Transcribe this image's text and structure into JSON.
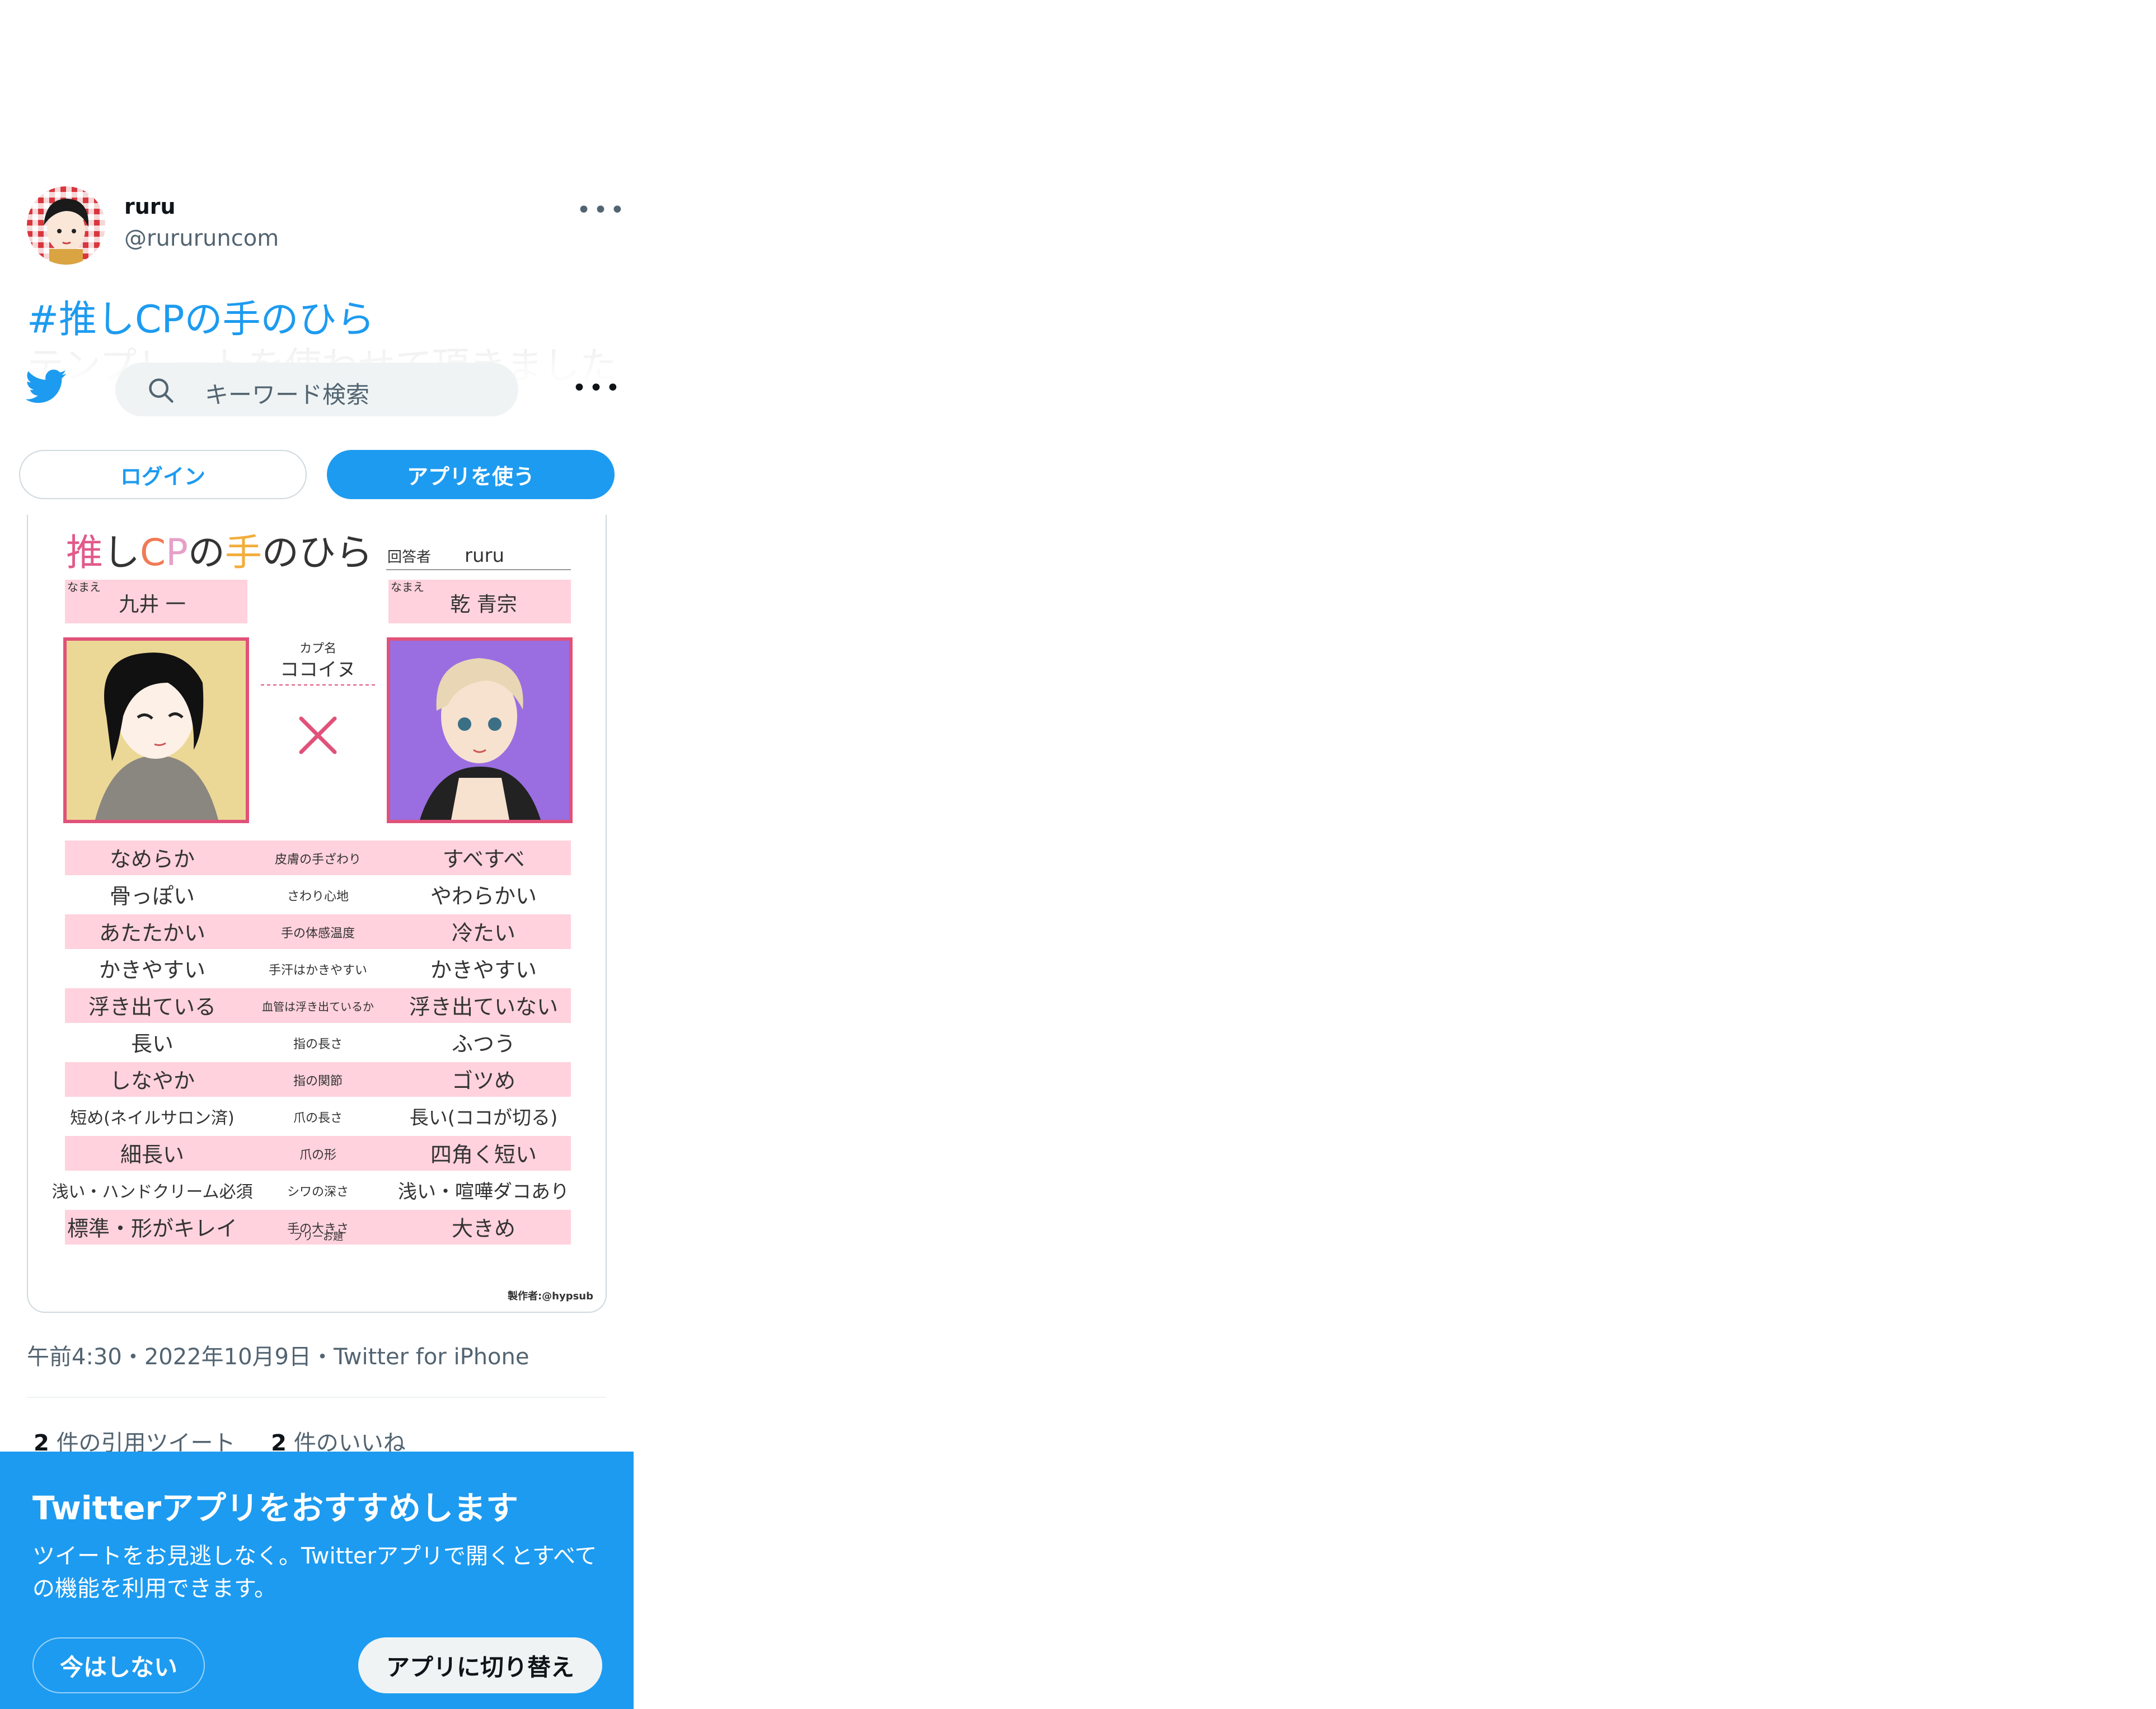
{
  "tweet": {
    "author_name": "ruru",
    "author_handle": "@rururuncom",
    "hashtag": "#推しCPの手のひら",
    "text_line2": "テンプレートを使わせて頂きました",
    "timestamp": "午前4:30・2022年10月9日・Twitter for iPhone",
    "quote_count": "2",
    "quote_label": "件の引用ツイート",
    "like_count": "2",
    "like_label": "件のいいね"
  },
  "topbar": {
    "search_placeholder": "キーワード検索",
    "login_label": "ログイン",
    "use_app_label": "アプリを使う"
  },
  "sheet": {
    "title": "Twitterアプリをおすすめします",
    "body": "ツイートをお見逃しなく。Twitterアプリで開くとすべての機能を利用できます。",
    "not_now_label": "今はしない",
    "switch_label": "アプリに切り替え"
  },
  "template": {
    "title": "推しCPの手のひら",
    "answerer_label": "回答者",
    "answerer": "ruru",
    "name_label": "なまえ",
    "left_name": "九井 一",
    "right_name": "乾 青宗",
    "cp_label": "カプ名",
    "cp_name": "ココイヌ",
    "rows": [
      {
        "left": "なめらか",
        "label": "皮膚の手ざわり",
        "right": "すべすべ"
      },
      {
        "left": "骨っぽい",
        "label": "さわり心地",
        "right": "やわらかい"
      },
      {
        "left": "あたたかい",
        "label": "手の体感温度",
        "right": "冷たい"
      },
      {
        "left": "かきやすい",
        "label": "手汗はかきやすい",
        "right": "かきやすい"
      },
      {
        "left": "浮き出ている",
        "label": "血管は浮き出ているか",
        "right": "浮き出ていない"
      },
      {
        "left": "長い",
        "label": "指の長さ",
        "right": "ふつう"
      },
      {
        "left": "しなやか",
        "label": "指の関節",
        "right": "ゴツめ"
      },
      {
        "left": "短め(ネイルサロン済)",
        "label": "爪の長さ",
        "right": "長い(ココが切る)"
      },
      {
        "left": "細長い",
        "label": "爪の形",
        "right": "四角く短い"
      },
      {
        "left": "浅い・ハンドクリーム必須",
        "label": "シワの深さ",
        "right": "浅い・喧嘩ダコあり"
      },
      {
        "left": "標準・形がキレイ",
        "label": "手の大きさ",
        "right": "大きめ"
      }
    ],
    "free_label": "フリーお題",
    "credit": "製作者:@hypsub"
  },
  "colors": {
    "accent": "#1d9bf0",
    "row_pink": "#ffd2dd",
    "frame_pink": "#e0527a",
    "left_bg": "#ecd896",
    "right_bg": "#9a6ee0"
  }
}
